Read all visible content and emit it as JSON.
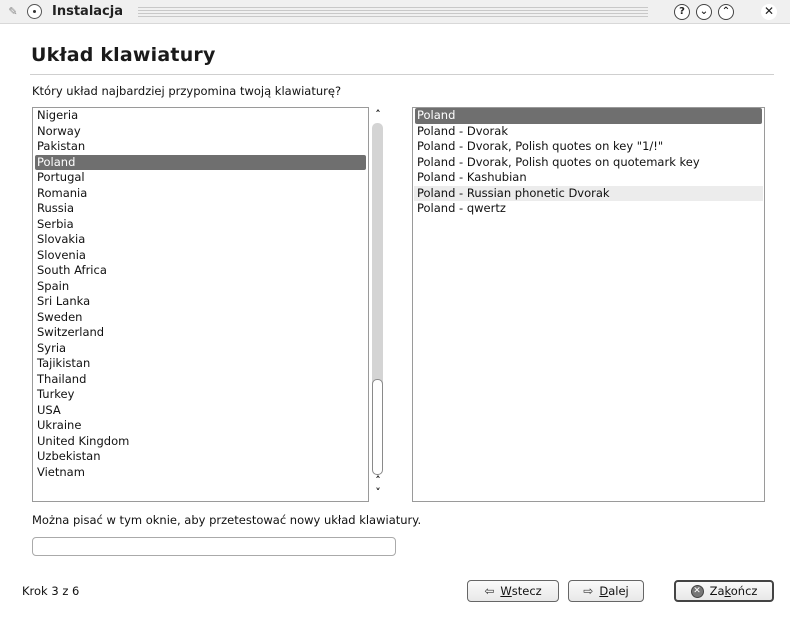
{
  "window": {
    "title": "Instalacja",
    "help_glyph": "?",
    "minimize_glyph": "⌄",
    "maximize_glyph": "⌃",
    "close_glyph": "✕"
  },
  "page": {
    "title": "Układ klawiatury",
    "question": "Który układ najbardziej przypomina twoją klawiaturę?",
    "hint": "Można pisać w tym oknie, aby przetestować nowy układ klawiatury.",
    "test_input_value": "",
    "step": "Krok 3 z 6"
  },
  "countries": [
    "Nigeria",
    "Norway",
    "Pakistan",
    "Poland",
    "Portugal",
    "Romania",
    "Russia",
    "Serbia",
    "Slovakia",
    "Slovenia",
    "South Africa",
    "Spain",
    "Sri Lanka",
    "Sweden",
    "Switzerland",
    "Syria",
    "Tajikistan",
    "Thailand",
    "Turkey",
    "USA",
    "Ukraine",
    "United Kingdom",
    "Uzbekistan",
    "Vietnam"
  ],
  "selected_country": "Poland",
  "variants": [
    "Poland",
    "Poland - Dvorak",
    "Poland - Dvorak, Polish quotes on key \"1/!\"",
    "Poland - Dvorak, Polish quotes on quotemark key",
    "Poland - Kashubian",
    "Poland - Russian phonetic Dvorak",
    "Poland - qwertz"
  ],
  "selected_variant": "Poland",
  "hovered_variant": "Poland - Russian phonetic Dvorak",
  "buttons": {
    "back_mnemonic": "W",
    "back_rest": "stecz",
    "next_mnemonic": "D",
    "next_rest": "alej",
    "finish_pre": "Za",
    "finish_mnemonic": "k",
    "finish_rest": "ończ"
  },
  "icons": {
    "back": "arrow-left-icon",
    "next": "arrow-right-icon",
    "finish": "cancel-icon"
  }
}
